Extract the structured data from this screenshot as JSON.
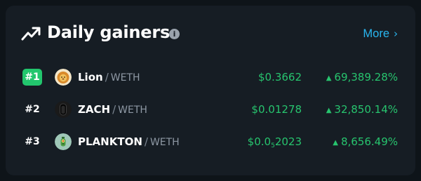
{
  "widget": {
    "title": "Daily gainers",
    "info_icon": "i",
    "more_label": "More",
    "more_chevron": "›",
    "accent_color": "#29b6f0",
    "gain_color": "#27c46e",
    "top_rank_color": "#22c66d"
  },
  "rows": [
    {
      "rank": "#1",
      "symbol": "Lion",
      "separator": "/",
      "quote": "WETH",
      "price_main": "$0.3662",
      "price_sub": "",
      "price_tail": "",
      "arrow": "▲",
      "change": "69,389.28%",
      "avatar_icon": "lion-avatar-icon"
    },
    {
      "rank": "#2",
      "symbol": "ZACH",
      "separator": "/",
      "quote": "WETH",
      "price_main": "$0.01278",
      "price_sub": "",
      "price_tail": "",
      "arrow": "▲",
      "change": "32,850.14%",
      "avatar_icon": "zach-avatar-icon"
    },
    {
      "rank": "#3",
      "symbol": "PLANKTON",
      "separator": "/",
      "quote": "WETH",
      "price_main": "$0.0",
      "price_sub": "5",
      "price_tail": "2023",
      "arrow": "▲",
      "change": "8,656.49%",
      "avatar_icon": "plankton-avatar-icon"
    }
  ]
}
